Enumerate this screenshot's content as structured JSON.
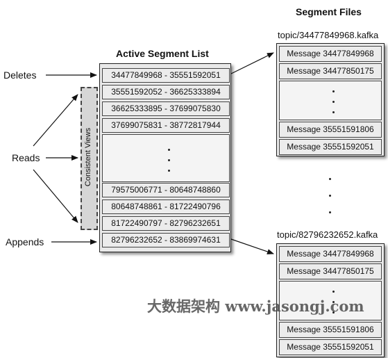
{
  "segment_files_title": "Segment Files",
  "active_segment_list_title": "Active Segment List",
  "labels": {
    "deletes": "Deletes",
    "reads": "Reads",
    "appends": "Appends",
    "consistent_views": "Consistent Views"
  },
  "segments_top": [
    "34477849968 - 35551592051",
    "35551592052 - 36625333894",
    "36625333895 - 37699075830",
    "37699075831 - 38772817944"
  ],
  "segments_bottom": [
    "79575006771 - 80648748860",
    "80648748861 - 81722490796",
    "81722490797 - 82796232651",
    "82796232652 - 83869974631"
  ],
  "files": [
    {
      "name": "topic/34477849968.kafka",
      "messages_top": [
        "Message 34477849968",
        "Message 34477850175"
      ],
      "messages_bottom": [
        "Message 35551591806",
        "Message 35551592051"
      ]
    },
    {
      "name": "topic/82796232652.kafka",
      "messages_top": [
        "Message 34477849968",
        "Message 34477850175"
      ],
      "messages_bottom": [
        "Message 35551591806",
        "Message 35551592051"
      ]
    }
  ],
  "watermark": "大数据架构 www.jasongj.com"
}
